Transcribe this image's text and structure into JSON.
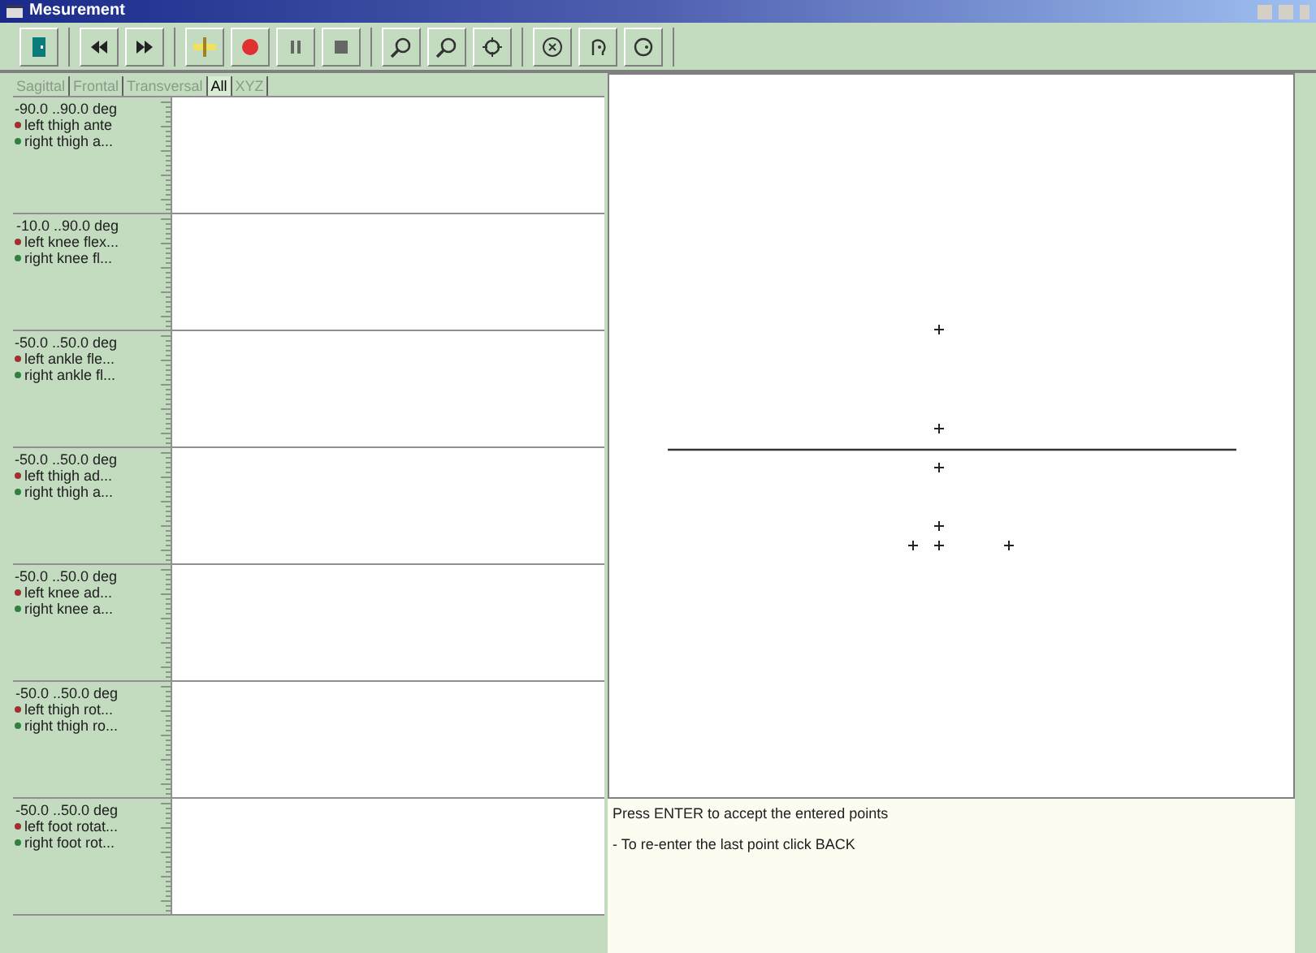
{
  "window": {
    "title": "Mesurement"
  },
  "toolbar": [
    {
      "buttons": [
        {
          "kind": "exit"
        }
      ]
    },
    {
      "buttons": [
        {
          "kind": "rewind"
        },
        {
          "kind": "forward"
        }
      ]
    },
    {
      "buttons": [
        {
          "kind": "marker"
        },
        {
          "kind": "record"
        },
        {
          "kind": "pause"
        },
        {
          "kind": "stop"
        }
      ]
    },
    {
      "buttons": [
        {
          "kind": "zoom-in"
        },
        {
          "kind": "zoom-out"
        },
        {
          "kind": "fit"
        }
      ]
    },
    {
      "buttons": [
        {
          "kind": "face"
        },
        {
          "kind": "side"
        },
        {
          "kind": "circle"
        }
      ]
    }
  ],
  "tabs": [
    {
      "label": "Sagittal",
      "selected": false
    },
    {
      "label": "Frontal",
      "selected": false
    },
    {
      "label": "Transversal",
      "selected": false
    },
    {
      "label": "All",
      "selected": true
    },
    {
      "label": "XYZ",
      "selected": false
    }
  ],
  "graphs": [
    {
      "range": "-90.0 ..90.0 deg",
      "series": [
        {
          "label": "left thigh ante",
          "color": "#a03030"
        },
        {
          "label": "right thigh a...",
          "color": "#308040"
        }
      ]
    },
    {
      "range": "-10.0 ..90.0 deg",
      "series": [
        {
          "label": "left knee flex...",
          "color": "#a03030"
        },
        {
          "label": "right knee fl...",
          "color": "#308040"
        }
      ]
    },
    {
      "range": "-50.0 ..50.0 deg",
      "series": [
        {
          "label": "left ankle fle...",
          "color": "#a03030"
        },
        {
          "label": "right ankle fl...",
          "color": "#308040"
        }
      ]
    },
    {
      "range": "-50.0 ..50.0 deg",
      "series": [
        {
          "label": "left thigh ad...",
          "color": "#a03030"
        },
        {
          "label": "right thigh a...",
          "color": "#308040"
        }
      ]
    },
    {
      "range": "-50.0 ..50.0 deg",
      "series": [
        {
          "label": "left knee ad...",
          "color": "#a03030"
        },
        {
          "label": "right knee a...",
          "color": "#308040"
        }
      ]
    },
    {
      "range": "-50.0 ..50.0 deg",
      "series": [
        {
          "label": "left thigh rot...",
          "color": "#a03030"
        },
        {
          "label": "right thigh ro...",
          "color": "#308040"
        }
      ]
    },
    {
      "range": "-50.0 ..50.0 deg",
      "series": [
        {
          "label": "left foot rotat...",
          "color": "#a03030"
        },
        {
          "label": "right foot rot...",
          "color": "#308040"
        }
      ]
    }
  ],
  "messages": [
    "Press ENTER to accept the entered points",
    "- To re-enter the last point click BACK"
  ]
}
